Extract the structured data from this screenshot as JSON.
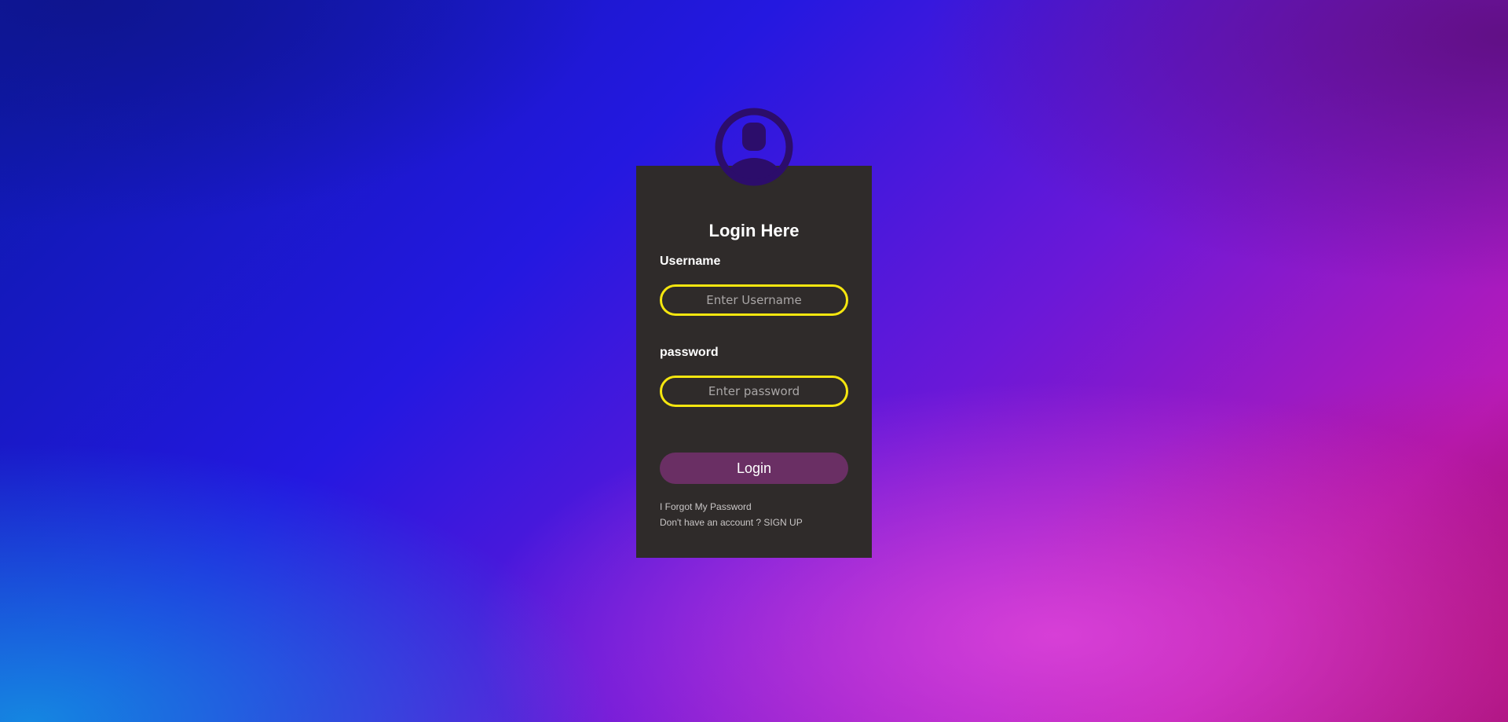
{
  "login": {
    "title": "Login Here",
    "username": {
      "label": "Username",
      "placeholder": "Enter Username",
      "value": ""
    },
    "password": {
      "label": "password",
      "placeholder": "Enter password",
      "value": ""
    },
    "submit_label": "Login",
    "forgot_password": "I Forgot My Password",
    "signup": "Don't have an account ? SIGN UP"
  },
  "icons": {
    "avatar": "user-avatar-icon"
  },
  "colors": {
    "card_background": "#2f2b2a",
    "input_border": "#f5e60f",
    "button_background": "#6a2f64",
    "avatar": "#2c0d6b"
  }
}
